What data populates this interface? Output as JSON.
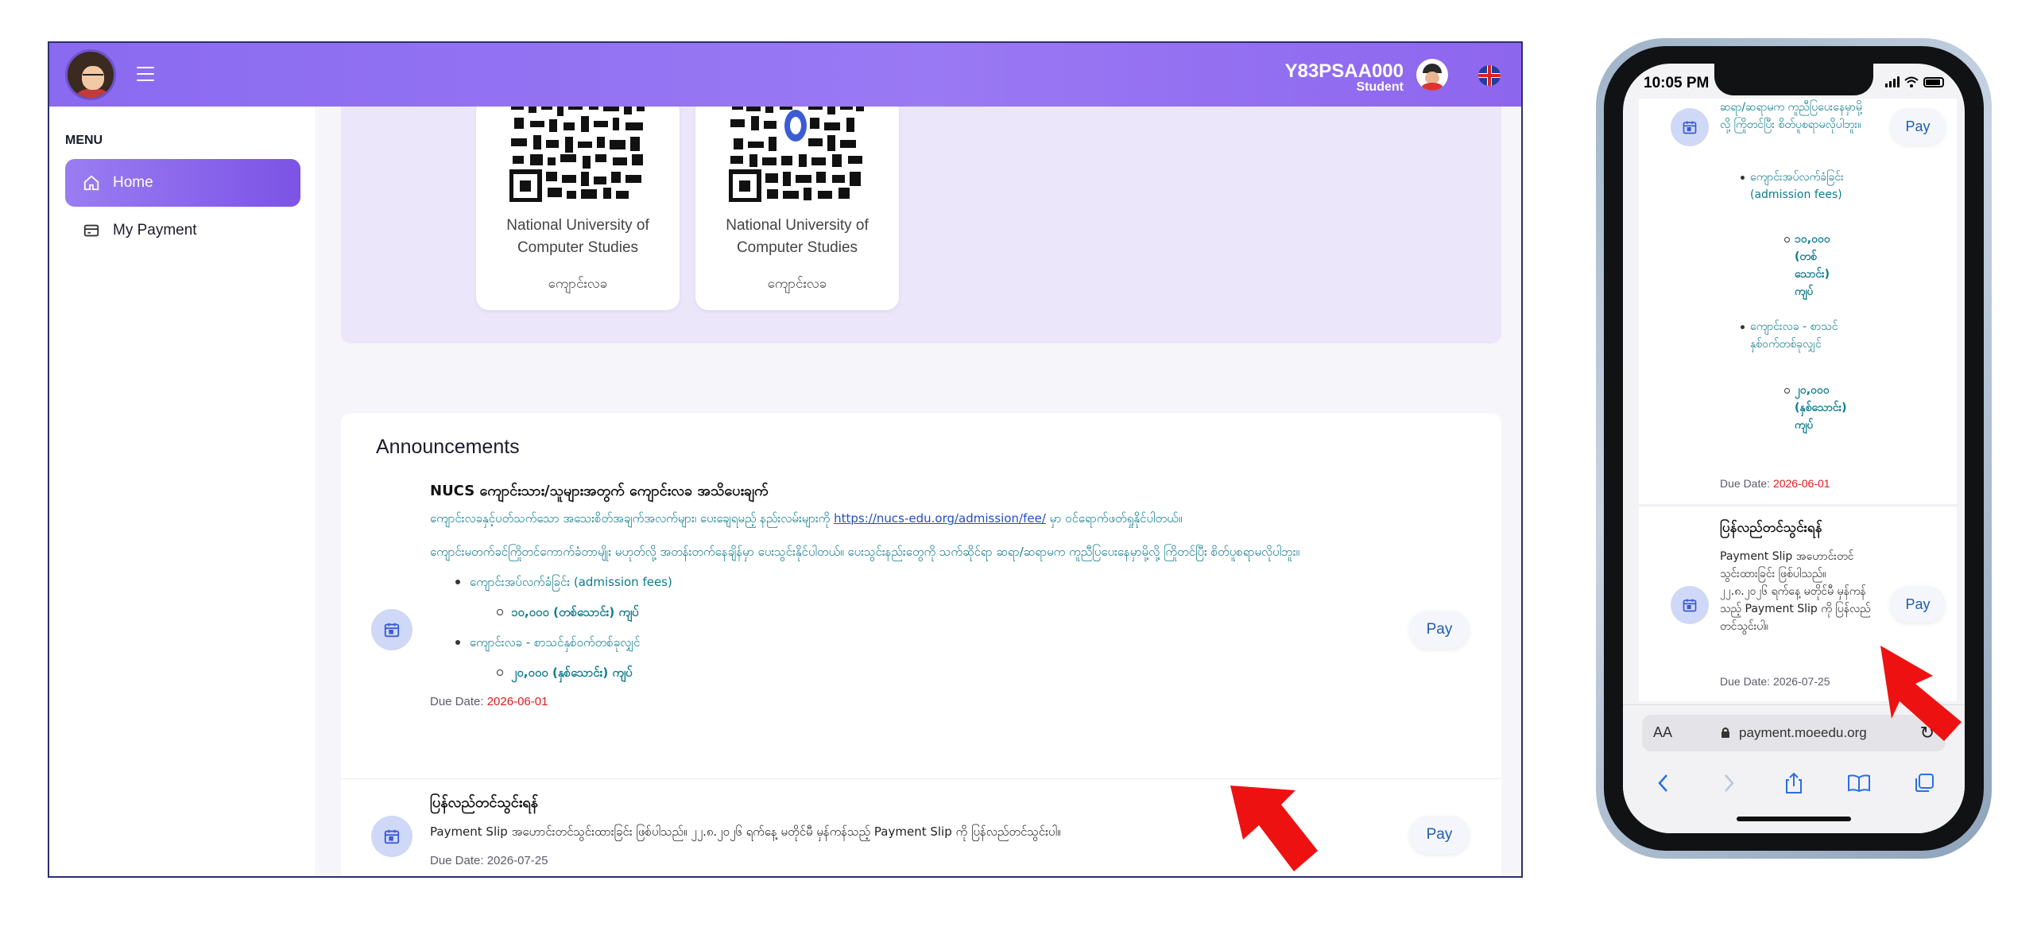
{
  "desktop": {
    "header": {
      "user_id": "Y83PSAA000",
      "user_role": "Student"
    },
    "sidebar": {
      "menu_label": "MENU",
      "items": [
        {
          "label": "Home",
          "active": true
        },
        {
          "label": "My Payment",
          "active": false
        }
      ]
    },
    "qr_cards": [
      {
        "name": "National University of Computer Studies",
        "fee_type": "ကျောင်းလခ"
      },
      {
        "name": "National University of Computer Studies",
        "fee_type": "ကျောင်းလခ"
      }
    ],
    "announcements": {
      "title": "Announcements",
      "items": [
        {
          "heading": "NUCS ကျောင်းသား/သူများအတွက် ကျောင်းလခ အသိပေးချက်",
          "para1_prefix": "ကျောင်းလခနှင့်ပတ်သက်သော အသေးစိတ်အချက်အလက်များ၊ ပေးချေရမည့် နည်းလမ်းများကို",
          "para1_link": "https://nucs-edu.org/admission/fee/",
          "para1_suffix": "မှာ ဝင်ရောက်ဖတ်ရှုနိုင်ပါတယ်။",
          "para2": "ကျောင်းမတက်ခင်ကြိုတင်ကောက်ခံတာမျိုး မဟုတ်လို့ အတန်းတက်နေချိန်မှာ ပေးသွင်းနိုင်ပါတယ်။ ပေးသွင်းနည်းတွေကို သက်ဆိုင်ရာ ဆရာ/ဆရာမက ကူညီပြပေးနေမှာမို့လို့ ကြိုတင်ပြီး စိတ်ပူစရာမလိုပါဘူး။",
          "bullet1": "ကျောင်းအပ်လက်ခံခြင်း (admission fees)",
          "bullet1_sub": "၁၀,၀၀၀ (တစ်သောင်း) ကျပ်",
          "bullet2": "ကျောင်းလခ - စာသင်နှစ်ဝက်တစ်ခုလျှင်",
          "bullet2_sub": "၂၀,၀၀၀ (နှစ်သောင်း) ကျပ်",
          "due_label": "Due Date:",
          "due_date": "2026-06-01",
          "pay_label": "Pay"
        },
        {
          "heading": "ပြန်လည်တင်သွင်းရန်",
          "body": "Payment Slip အဟောင်းတင်သွင်းထားခြင်း ဖြစ်ပါသည်။ ၂၂.၈.၂၀၂၆ ရက်နေ့ မတိုင်မီ မှန်ကန်သည့် Payment Slip ကို ပြန်လည်တင်သွင်းပါ။",
          "due_label": "Due Date:",
          "due_date": "2026-07-25",
          "pay_label": "Pay"
        }
      ]
    }
  },
  "mobile": {
    "status_time": "10:05 PM",
    "card1": {
      "text_top": "ဆရာ/ဆရာမက ကူညီပြပေးနေမှာမို့လို့ ကြိုတင်ပြီး စိတ်ပူစရာမလိုပါဘူး။",
      "bullet1": "ကျောင်းအပ်လက်ခံခြင်း (admission fees)",
      "bullet1_sub": "၁၀,၀၀၀ (တစ်သောင်း) ကျပ်",
      "bullet2": "ကျောင်းလခ - စာသင်နှစ်ဝက်တစ်ခုလျှင်",
      "bullet2_sub": "၂၀,၀၀၀ (နှစ်သောင်း) ကျပ်",
      "due_label": "Due Date:",
      "due_date": "2026-06-01",
      "pay_label": "Pay"
    },
    "card2": {
      "heading": "ပြန်လည်တင်သွင်းရန်",
      "body": "Payment Slip အဟောင်းတင်သွင်းထားခြင်း ဖြစ်ပါသည်။ ၂၂.၈.၂၀၂၆ ရက်နေ့ မတိုင်မီ မှန်ကန်သည့် Payment Slip ကို ပြန်လည်တင်သွင်းပါ။",
      "due_label": "Due Date:",
      "due_date": "2026-07-25",
      "pay_label": "Pay"
    },
    "browser": {
      "aa_label": "AA",
      "url": "payment.moeedu.org"
    }
  },
  "colors": {
    "accent_purple": "#8a6af0",
    "teal_text": "#0d7a8c",
    "pay_blue": "#1f5db0",
    "due_red": "#e01a1a",
    "arrow_red": "#ee1111"
  }
}
